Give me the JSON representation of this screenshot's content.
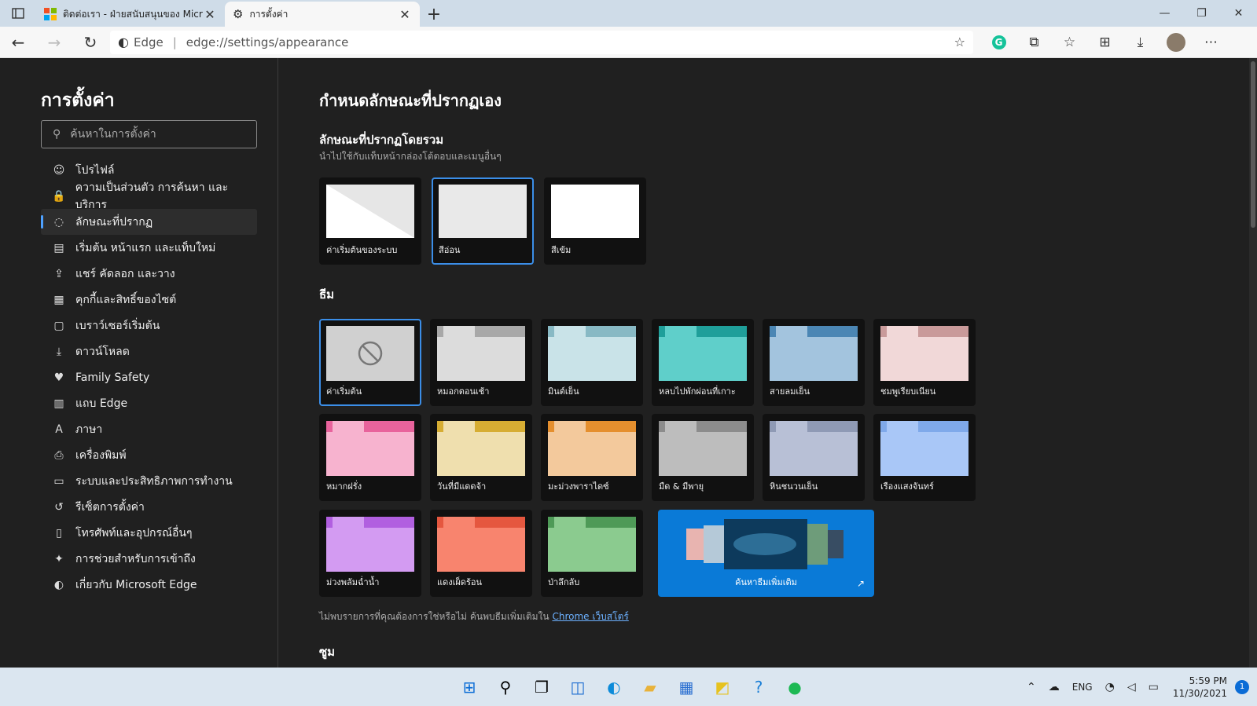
{
  "browser": {
    "tabs": [
      {
        "title": "ติดต่อเรา - ฝ่ายสนับสนุนของ Microso",
        "active": false
      },
      {
        "title": "การตั้งค่า",
        "active": true
      }
    ],
    "address": {
      "label": "Edge",
      "url": "edge://settings/appearance"
    }
  },
  "sidebar": {
    "title": "การตั้งค่า",
    "search_placeholder": "ค้นหาในการตั้งค่า",
    "items": [
      {
        "label": "โปรไฟล์",
        "icon": "profile-icon"
      },
      {
        "label": "ความเป็นส่วนตัว การค้นหา และบริการ",
        "icon": "lock-icon"
      },
      {
        "label": "ลักษณะที่ปรากฏ",
        "icon": "palette-icon",
        "selected": true
      },
      {
        "label": "เริ่มต้น หน้าแรก และแท็บใหม่",
        "icon": "start-icon"
      },
      {
        "label": "แชร์ คัดลอก และวาง",
        "icon": "share-icon"
      },
      {
        "label": "คุกกี้และสิทธิ์ของไซต์",
        "icon": "cookie-icon"
      },
      {
        "label": "เบราว์เซอร์เริ่มต้น",
        "icon": "browser-icon"
      },
      {
        "label": "ดาวน์โหลด",
        "icon": "download-icon"
      },
      {
        "label": "Family Safety",
        "icon": "family-icon"
      },
      {
        "label": "แถบ Edge",
        "icon": "edge-bar-icon"
      },
      {
        "label": "ภาษา",
        "icon": "language-icon"
      },
      {
        "label": "เครื่องพิมพ์",
        "icon": "printer-icon"
      },
      {
        "label": "ระบบและประสิทธิภาพการทำงาน",
        "icon": "laptop-icon"
      },
      {
        "label": "รีเซ็ตการตั้งค่า",
        "icon": "reset-icon"
      },
      {
        "label": "โทรศัพท์และอุปกรณ์อื่นๆ",
        "icon": "phone-icon"
      },
      {
        "label": "การช่วยสำหรับการเข้าถึง",
        "icon": "accessibility-icon"
      },
      {
        "label": "เกี่ยวกับ Microsoft Edge",
        "icon": "edge-icon"
      }
    ]
  },
  "main": {
    "title": "กำหนดลักษณะที่ปรากฏเอง",
    "overall": {
      "heading": "ลักษณะที่ปรากฏโดยรวม",
      "subtitle": "นำไปใช้กับแท็บหน้ากล่องโต้ตอบและเมนูอื่นๆ",
      "options": [
        {
          "label": "ค่าเริ่มต้นของระบบ",
          "selected": false
        },
        {
          "label": "สีอ่อน",
          "selected": true
        },
        {
          "label": "สีเข้ม",
          "selected": false
        }
      ]
    },
    "themes": {
      "heading": "ธีม",
      "items": [
        {
          "label": "ค่าเริ่มต้น",
          "selected": true,
          "tab": "#cfcfcf",
          "body": "#d4d4d4"
        },
        {
          "label": "หมอกตอนเช้า",
          "tab": "#a8a8a8",
          "body": "#dcdcdc"
        },
        {
          "label": "มินต์เย็น",
          "tab": "#88b9c4",
          "body": "#c9e3e8"
        },
        {
          "label": "หลบไปพักผ่อนที่เกาะ",
          "tab": "#1f9f9a",
          "body": "#5fcfca"
        },
        {
          "label": "สายลมเย็น",
          "tab": "#4b86b4",
          "body": "#a3c4de"
        },
        {
          "label": "ชมพูเรียบเนียน",
          "tab": "#c99a9a",
          "body": "#f1d8d8"
        },
        {
          "label": "หมากฝรั่ง",
          "tab": "#e8639c",
          "body": "#f7b3cf"
        },
        {
          "label": "วันที่มีแดดจ้า",
          "tab": "#d6ad33",
          "body": "#efdfae"
        },
        {
          "label": "มะม่วงพาราไดซ์",
          "tab": "#e58f2e",
          "body": "#f3c99c"
        },
        {
          "label": "มืด & มีพายุ",
          "tab": "#8c8c8c",
          "body": "#bdbdbd"
        },
        {
          "label": "หินชนวนเย็น",
          "tab": "#8f9ab5",
          "body": "#b8c0d6"
        },
        {
          "label": "เรืองแสงจันทร์",
          "tab": "#7fa9ea",
          "body": "#a9c7f7"
        },
        {
          "label": "ม่วงพลัมฉ่ำน้ำ",
          "tab": "#b15fe0",
          "body": "#d39bf2"
        },
        {
          "label": "แดงเผ็ดร้อน",
          "tab": "#e5573f",
          "body": "#f8846e"
        },
        {
          "label": "ป่าลึกลับ",
          "tab": "#4e9a57",
          "body": "#8bcb8f"
        }
      ],
      "more_label": "ค้นหาธีมเพิ่มเติม"
    },
    "footnote": "ไม่พบรายการที่คุณต้องการใช่หรือไม่ ค้นพบธีมเพิ่มเติมใน",
    "footnote_link": "Chrome เว็บสโตร์",
    "next_heading": "ซูม"
  },
  "taskbar": {
    "lang": "ENG",
    "time": "5:59 PM",
    "date": "11/30/2021",
    "notifications": "1"
  }
}
